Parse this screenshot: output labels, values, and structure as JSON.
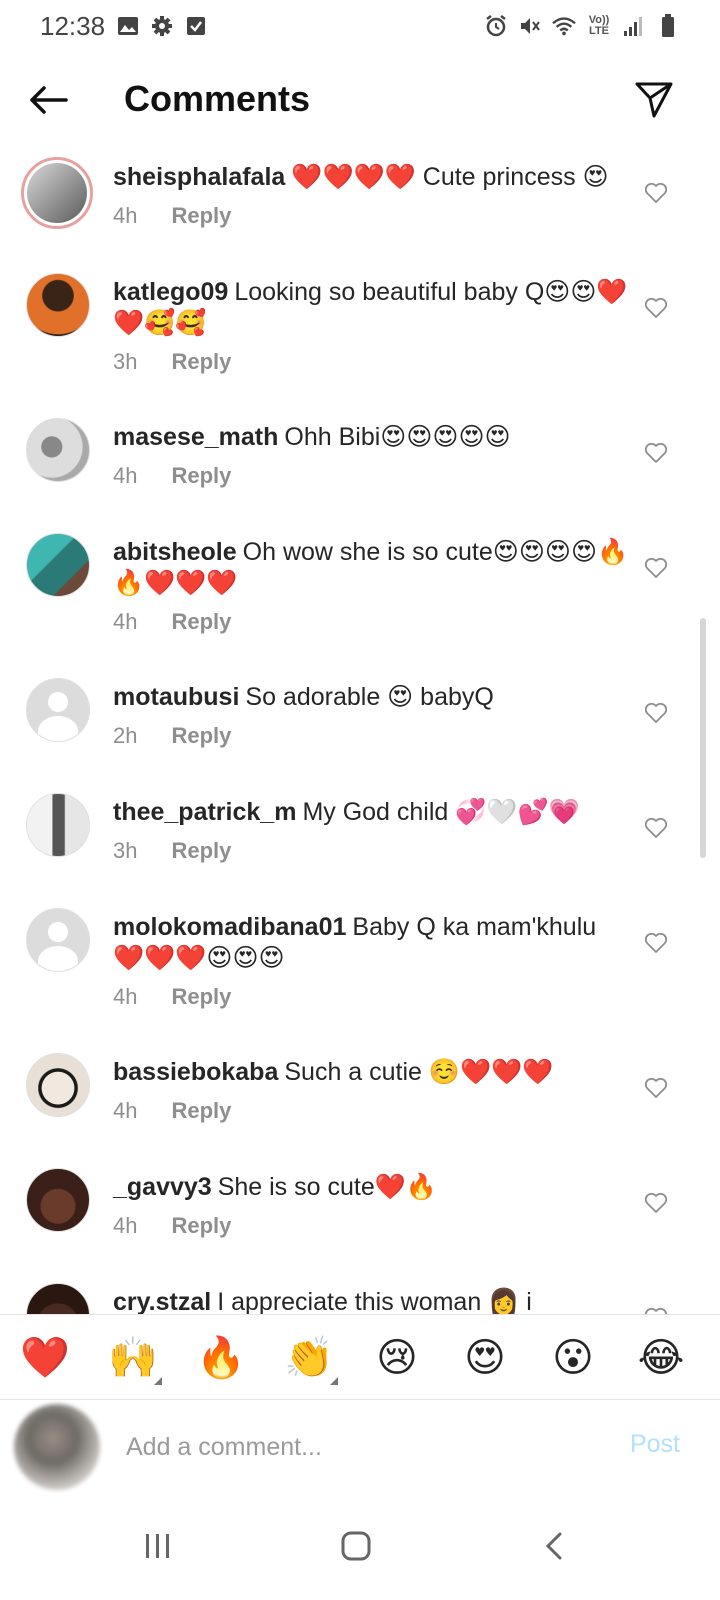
{
  "status_bar": {
    "time": "12:38",
    "network_label": "Vo)) LTE"
  },
  "header": {
    "title": "Comments"
  },
  "comments": [
    {
      "username": "sheisphalafala",
      "text": "❤️❤️❤️❤️ Cute princess 😍",
      "time": "4h",
      "reply": "Reply",
      "avatar": "story-ring"
    },
    {
      "username": "katlego09",
      "text": "Looking so beautiful baby Q😍😍❤️❤️🥰🥰",
      "time": "3h",
      "reply": "Reply",
      "avatar": "photo"
    },
    {
      "username": "masese_math",
      "text": "Ohh Bibi😍😍😍😍😍",
      "time": "4h",
      "reply": "Reply",
      "avatar": "photo"
    },
    {
      "username": "abitsheole",
      "text": "Oh wow she is so cute😍😍😍😍🔥🔥❤️❤️❤️",
      "time": "4h",
      "reply": "Reply",
      "avatar": "photo"
    },
    {
      "username": "motaubusi",
      "text": "So adorable 😍 babyQ",
      "time": "2h",
      "reply": "Reply",
      "avatar": "default"
    },
    {
      "username": "thee_patrick_m",
      "text": "My God child 💞🤍💕💗",
      "time": "3h",
      "reply": "Reply",
      "avatar": "photo"
    },
    {
      "username": "molokomadibana01",
      "text": "Baby Q ka mam'khulu ❤️❤️❤️😍😍😍",
      "time": "4h",
      "reply": "Reply",
      "avatar": "default"
    },
    {
      "username": "bassiebokaba",
      "text": "Such a cutie ☺️❤️❤️❤️",
      "time": "4h",
      "reply": "Reply",
      "avatar": "photo"
    },
    {
      "username": "_gavvy3",
      "text": "She is so cute❤️🔥",
      "time": "4h",
      "reply": "Reply",
      "avatar": "photo"
    },
    {
      "username": "cry.stzal",
      "text": "I appreciate this woman 👩 i",
      "time": "",
      "reply": "",
      "avatar": "photo"
    }
  ],
  "reactions": [
    "❤️",
    "🙌",
    "🔥",
    "👏",
    "😢",
    "😍",
    "😮",
    "😂"
  ],
  "add_comment": {
    "placeholder": "Add a comment...",
    "post_label": "Post"
  },
  "colors": {
    "post_disabled": "#b2dffc",
    "meta_gray": "#8e8e8e",
    "heart_red": "#e0245e"
  }
}
